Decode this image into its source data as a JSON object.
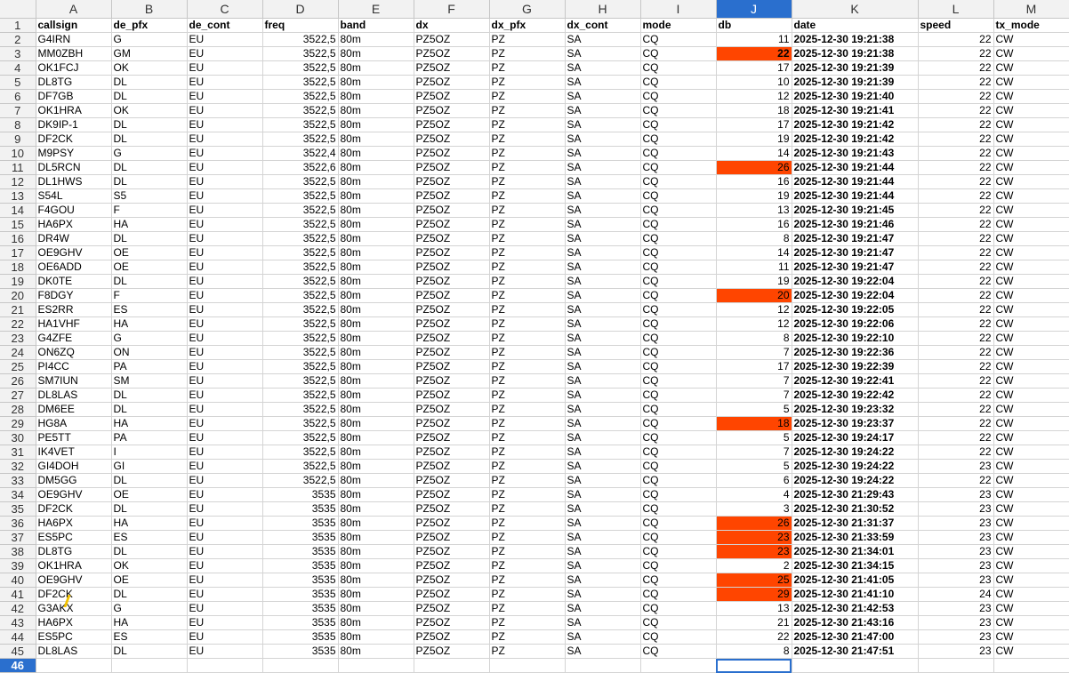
{
  "sheet": {
    "columns": [
      "A",
      "B",
      "C",
      "D",
      "E",
      "F",
      "G",
      "H",
      "I",
      "J",
      "K",
      "L",
      "M"
    ],
    "active_column": "J",
    "active_row": "46",
    "highlight_color": "#ff4500",
    "selection_color": "#2a6fce",
    "headers": [
      "callsign",
      "de_pfx",
      "de_cont",
      "freq",
      "band",
      "dx",
      "dx_pfx",
      "dx_cont",
      "mode",
      "db",
      "date",
      "speed",
      "tx_mode"
    ],
    "rows": [
      [
        "G4IRN",
        "G",
        "EU",
        "3522,5",
        "80m",
        "PZ5OZ",
        "PZ",
        "SA",
        "CQ",
        "11",
        "2025-12-30 19:21:38",
        "22",
        "CW"
      ],
      [
        "MM0ZBH",
        "GM",
        "EU",
        "3522,5",
        "80m",
        "PZ5OZ",
        "PZ",
        "SA",
        "CQ",
        "22",
        "2025-12-30 19:21:38",
        "22",
        "CW"
      ],
      [
        "OK1FCJ",
        "OK",
        "EU",
        "3522,5",
        "80m",
        "PZ5OZ",
        "PZ",
        "SA",
        "CQ",
        "17",
        "2025-12-30 19:21:39",
        "22",
        "CW"
      ],
      [
        "DL8TG",
        "DL",
        "EU",
        "3522,5",
        "80m",
        "PZ5OZ",
        "PZ",
        "SA",
        "CQ",
        "10",
        "2025-12-30 19:21:39",
        "22",
        "CW"
      ],
      [
        "DF7GB",
        "DL",
        "EU",
        "3522,5",
        "80m",
        "PZ5OZ",
        "PZ",
        "SA",
        "CQ",
        "12",
        "2025-12-30 19:21:40",
        "22",
        "CW"
      ],
      [
        "OK1HRA",
        "OK",
        "EU",
        "3522,5",
        "80m",
        "PZ5OZ",
        "PZ",
        "SA",
        "CQ",
        "18",
        "2025-12-30 19:21:41",
        "22",
        "CW"
      ],
      [
        "DK9IP-1",
        "DL",
        "EU",
        "3522,5",
        "80m",
        "PZ5OZ",
        "PZ",
        "SA",
        "CQ",
        "17",
        "2025-12-30 19:21:42",
        "22",
        "CW"
      ],
      [
        "DF2CK",
        "DL",
        "EU",
        "3522,5",
        "80m",
        "PZ5OZ",
        "PZ",
        "SA",
        "CQ",
        "19",
        "2025-12-30 19:21:42",
        "22",
        "CW"
      ],
      [
        "M9PSY",
        "G",
        "EU",
        "3522,4",
        "80m",
        "PZ5OZ",
        "PZ",
        "SA",
        "CQ",
        "14",
        "2025-12-30 19:21:43",
        "22",
        "CW"
      ],
      [
        "DL5RCN",
        "DL",
        "EU",
        "3522,6",
        "80m",
        "PZ5OZ",
        "PZ",
        "SA",
        "CQ",
        "26",
        "2025-12-30 19:21:44",
        "22",
        "CW"
      ],
      [
        "DL1HWS",
        "DL",
        "EU",
        "3522,5",
        "80m",
        "PZ5OZ",
        "PZ",
        "SA",
        "CQ",
        "16",
        "2025-12-30 19:21:44",
        "22",
        "CW"
      ],
      [
        "S54L",
        "S5",
        "EU",
        "3522,5",
        "80m",
        "PZ5OZ",
        "PZ",
        "SA",
        "CQ",
        "19",
        "2025-12-30 19:21:44",
        "22",
        "CW"
      ],
      [
        "F4GOU",
        "F",
        "EU",
        "3522,5",
        "80m",
        "PZ5OZ",
        "PZ",
        "SA",
        "CQ",
        "13",
        "2025-12-30 19:21:45",
        "22",
        "CW"
      ],
      [
        "HA6PX",
        "HA",
        "EU",
        "3522,5",
        "80m",
        "PZ5OZ",
        "PZ",
        "SA",
        "CQ",
        "16",
        "2025-12-30 19:21:46",
        "22",
        "CW"
      ],
      [
        "DR4W",
        "DL",
        "EU",
        "3522,5",
        "80m",
        "PZ5OZ",
        "PZ",
        "SA",
        "CQ",
        "8",
        "2025-12-30 19:21:47",
        "22",
        "CW"
      ],
      [
        "OE9GHV",
        "OE",
        "EU",
        "3522,5",
        "80m",
        "PZ5OZ",
        "PZ",
        "SA",
        "CQ",
        "14",
        "2025-12-30 19:21:47",
        "22",
        "CW"
      ],
      [
        "OE6ADD",
        "OE",
        "EU",
        "3522,5",
        "80m",
        "PZ5OZ",
        "PZ",
        "SA",
        "CQ",
        "11",
        "2025-12-30 19:21:47",
        "22",
        "CW"
      ],
      [
        "DK0TE",
        "DL",
        "EU",
        "3522,5",
        "80m",
        "PZ5OZ",
        "PZ",
        "SA",
        "CQ",
        "19",
        "2025-12-30 19:22:04",
        "22",
        "CW"
      ],
      [
        "F8DGY",
        "F",
        "EU",
        "3522,5",
        "80m",
        "PZ5OZ",
        "PZ",
        "SA",
        "CQ",
        "20",
        "2025-12-30 19:22:04",
        "22",
        "CW"
      ],
      [
        "ES2RR",
        "ES",
        "EU",
        "3522,5",
        "80m",
        "PZ5OZ",
        "PZ",
        "SA",
        "CQ",
        "12",
        "2025-12-30 19:22:05",
        "22",
        "CW"
      ],
      [
        "HA1VHF",
        "HA",
        "EU",
        "3522,5",
        "80m",
        "PZ5OZ",
        "PZ",
        "SA",
        "CQ",
        "12",
        "2025-12-30 19:22:06",
        "22",
        "CW"
      ],
      [
        "G4ZFE",
        "G",
        "EU",
        "3522,5",
        "80m",
        "PZ5OZ",
        "PZ",
        "SA",
        "CQ",
        "8",
        "2025-12-30 19:22:10",
        "22",
        "CW"
      ],
      [
        "ON6ZQ",
        "ON",
        "EU",
        "3522,5",
        "80m",
        "PZ5OZ",
        "PZ",
        "SA",
        "CQ",
        "7",
        "2025-12-30 19:22:36",
        "22",
        "CW"
      ],
      [
        "PI4CC",
        "PA",
        "EU",
        "3522,5",
        "80m",
        "PZ5OZ",
        "PZ",
        "SA",
        "CQ",
        "17",
        "2025-12-30 19:22:39",
        "22",
        "CW"
      ],
      [
        "SM7IUN",
        "SM",
        "EU",
        "3522,5",
        "80m",
        "PZ5OZ",
        "PZ",
        "SA",
        "CQ",
        "7",
        "2025-12-30 19:22:41",
        "22",
        "CW"
      ],
      [
        "DL8LAS",
        "DL",
        "EU",
        "3522,5",
        "80m",
        "PZ5OZ",
        "PZ",
        "SA",
        "CQ",
        "7",
        "2025-12-30 19:22:42",
        "22",
        "CW"
      ],
      [
        "DM6EE",
        "DL",
        "EU",
        "3522,5",
        "80m",
        "PZ5OZ",
        "PZ",
        "SA",
        "CQ",
        "5",
        "2025-12-30 19:23:32",
        "22",
        "CW"
      ],
      [
        "HG8A",
        "HA",
        "EU",
        "3522,5",
        "80m",
        "PZ5OZ",
        "PZ",
        "SA",
        "CQ",
        "18",
        "2025-12-30 19:23:37",
        "22",
        "CW"
      ],
      [
        "PE5TT",
        "PA",
        "EU",
        "3522,5",
        "80m",
        "PZ5OZ",
        "PZ",
        "SA",
        "CQ",
        "5",
        "2025-12-30 19:24:17",
        "22",
        "CW"
      ],
      [
        "IK4VET",
        "I",
        "EU",
        "3522,5",
        "80m",
        "PZ5OZ",
        "PZ",
        "SA",
        "CQ",
        "7",
        "2025-12-30 19:24:22",
        "22",
        "CW"
      ],
      [
        "GI4DOH",
        "GI",
        "EU",
        "3522,5",
        "80m",
        "PZ5OZ",
        "PZ",
        "SA",
        "CQ",
        "5",
        "2025-12-30 19:24:22",
        "23",
        "CW"
      ],
      [
        "DM5GG",
        "DL",
        "EU",
        "3522,5",
        "80m",
        "PZ5OZ",
        "PZ",
        "SA",
        "CQ",
        "6",
        "2025-12-30 19:24:22",
        "22",
        "CW"
      ],
      [
        "OE9GHV",
        "OE",
        "EU",
        "3535",
        "80m",
        "PZ5OZ",
        "PZ",
        "SA",
        "CQ",
        "4",
        "2025-12-30 21:29:43",
        "23",
        "CW"
      ],
      [
        "DF2CK",
        "DL",
        "EU",
        "3535",
        "80m",
        "PZ5OZ",
        "PZ",
        "SA",
        "CQ",
        "3",
        "2025-12-30 21:30:52",
        "23",
        "CW"
      ],
      [
        "HA6PX",
        "HA",
        "EU",
        "3535",
        "80m",
        "PZ5OZ",
        "PZ",
        "SA",
        "CQ",
        "26",
        "2025-12-30 21:31:37",
        "23",
        "CW"
      ],
      [
        "ES5PC",
        "ES",
        "EU",
        "3535",
        "80m",
        "PZ5OZ",
        "PZ",
        "SA",
        "CQ",
        "23",
        "2025-12-30 21:33:59",
        "23",
        "CW"
      ],
      [
        "DL8TG",
        "DL",
        "EU",
        "3535",
        "80m",
        "PZ5OZ",
        "PZ",
        "SA",
        "CQ",
        "23",
        "2025-12-30 21:34:01",
        "23",
        "CW"
      ],
      [
        "OK1HRA",
        "OK",
        "EU",
        "3535",
        "80m",
        "PZ5OZ",
        "PZ",
        "SA",
        "CQ",
        "2",
        "2025-12-30 21:34:15",
        "23",
        "CW"
      ],
      [
        "OE9GHV",
        "OE",
        "EU",
        "3535",
        "80m",
        "PZ5OZ",
        "PZ",
        "SA",
        "CQ",
        "25",
        "2025-12-30 21:41:05",
        "23",
        "CW"
      ],
      [
        "DF2CK",
        "DL",
        "EU",
        "3535",
        "80m",
        "PZ5OZ",
        "PZ",
        "SA",
        "CQ",
        "29",
        "2025-12-30 21:41:10",
        "24",
        "CW"
      ],
      [
        "G3AKX",
        "G",
        "EU",
        "3535",
        "80m",
        "PZ5OZ",
        "PZ",
        "SA",
        "CQ",
        "13",
        "2025-12-30 21:42:53",
        "23",
        "CW"
      ],
      [
        "HA6PX",
        "HA",
        "EU",
        "3535",
        "80m",
        "PZ5OZ",
        "PZ",
        "SA",
        "CQ",
        "21",
        "2025-12-30 21:43:16",
        "23",
        "CW"
      ],
      [
        "ES5PC",
        "ES",
        "EU",
        "3535",
        "80m",
        "PZ5OZ",
        "PZ",
        "SA",
        "CQ",
        "22",
        "2025-12-30 21:47:00",
        "23",
        "CW"
      ],
      [
        "DL8LAS",
        "DL",
        "EU",
        "3535",
        "80m",
        "PZ5OZ",
        "PZ",
        "SA",
        "CQ",
        "8",
        "2025-12-30 21:47:51",
        "23",
        "CW"
      ]
    ],
    "highlighted_rows": [
      "3",
      "11",
      "20",
      "29",
      "36",
      "37",
      "38",
      "40",
      "41"
    ]
  }
}
